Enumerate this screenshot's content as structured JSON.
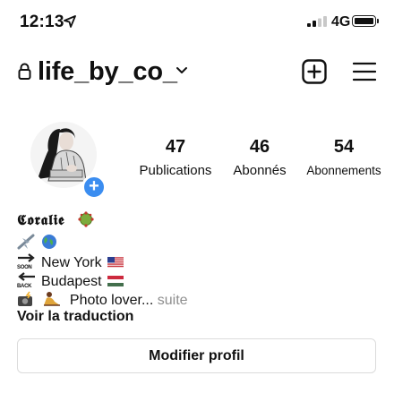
{
  "status_bar": {
    "time": "12:13",
    "network": "4G",
    "icons": [
      "location-arrow-icon",
      "signal-bars-icon",
      "battery-icon"
    ]
  },
  "header": {
    "username": "life_by_co_",
    "icons": [
      "lock-icon",
      "chevron-down-icon",
      "new-post-icon",
      "menu-icon"
    ]
  },
  "profile": {
    "stats": [
      {
        "value": "47",
        "label": "Publications"
      },
      {
        "value": "46",
        "label": "Abonnés"
      },
      {
        "value": "54",
        "label": "Abonnements"
      }
    ],
    "add_story_symbol": "+"
  },
  "bio": {
    "display_name": "𝕮𝖔𝖗𝖆𝖑𝖎𝖊",
    "line1_emojis": [
      "airplane",
      "globe"
    ],
    "soon_caption": "SOON",
    "back_caption": "BACK",
    "line2_text": "New York",
    "line3_text": "Budapest",
    "line4_text": "Photo lover...",
    "more_label": "suite",
    "translate_label": "Voir la traduction"
  },
  "actions": {
    "edit_profile_label": "Modifier profil"
  },
  "colors": {
    "accent": "#3b8df0",
    "muted_text": "#8e8e8e",
    "border": "#dbdbdb"
  }
}
